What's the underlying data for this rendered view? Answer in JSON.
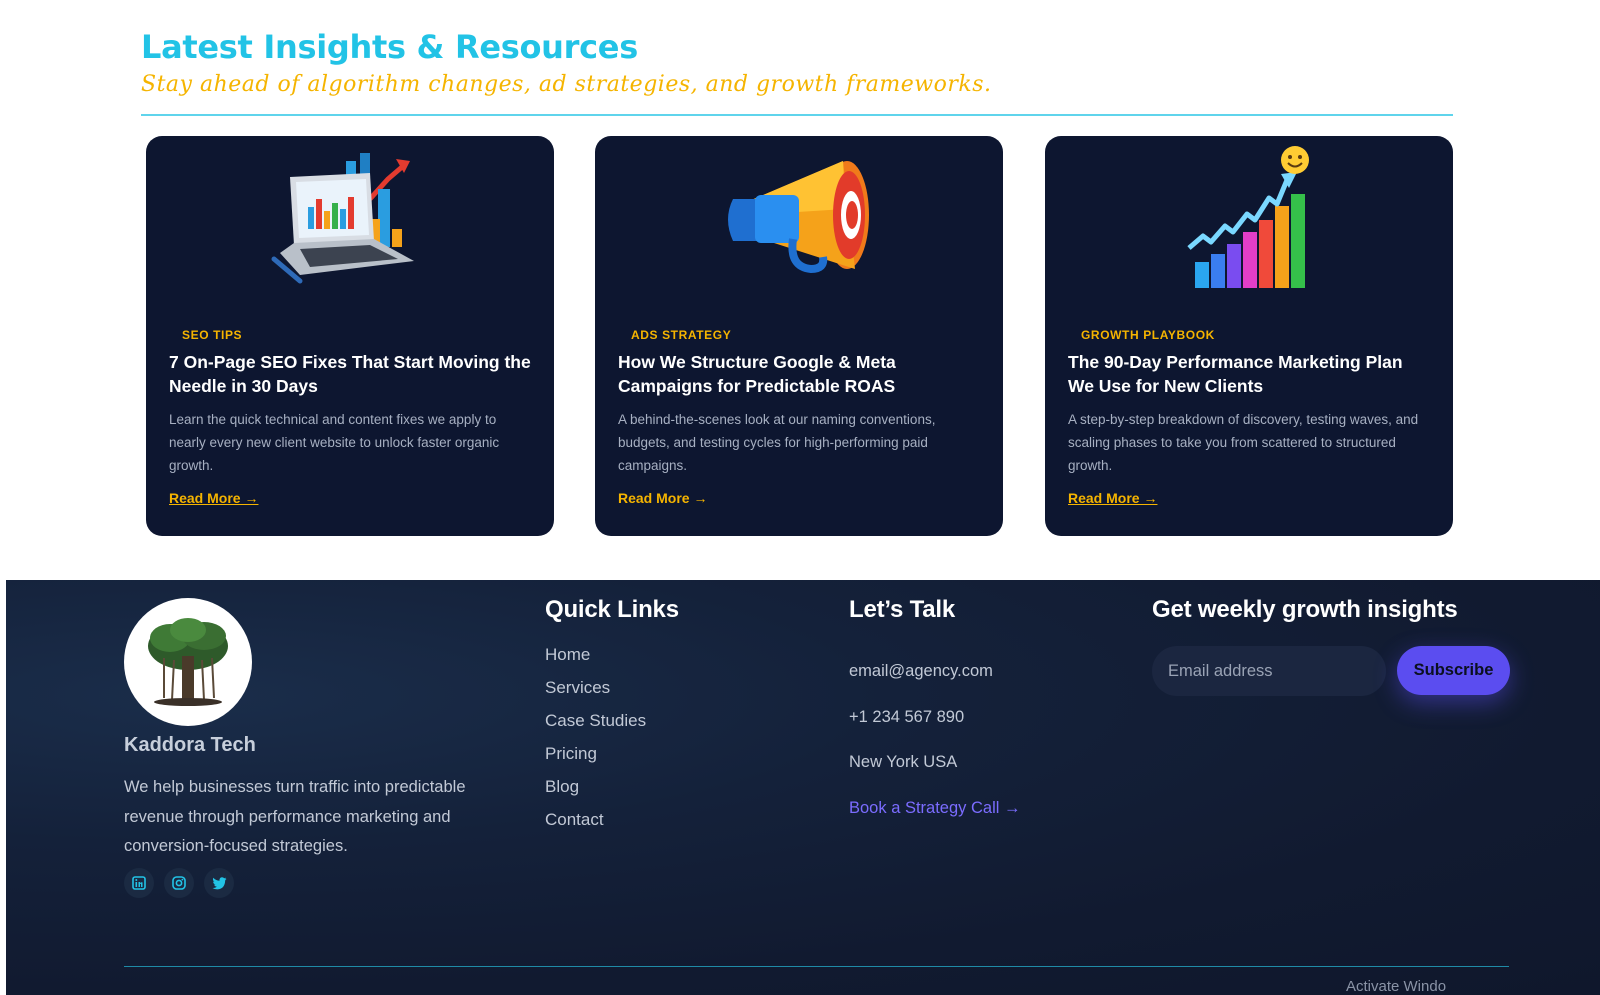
{
  "insights": {
    "title": "Latest Insights & Resources",
    "subtitle": "Stay ahead of algorithm changes, ad strategies, and growth frameworks.",
    "cards": [
      {
        "image_icon": "laptop-chart-icon",
        "tag": "SEO TIPS",
        "title": "7 On-Page SEO Fixes That Start Moving the Needle in 30 Days",
        "description": "Learn the quick technical and content fixes we apply to nearly every new client website to unlock faster organic growth.",
        "link_label": "Read More →"
      },
      {
        "image_icon": "megaphone-icon",
        "tag": "ADS STRATEGY",
        "title": "How We Structure Google & Meta Campaigns for Predictable ROAS",
        "description": "A behind-the-scenes look at our naming conventions, budgets, and testing cycles for high-performing paid campaigns.",
        "link_label": "Read More →"
      },
      {
        "image_icon": "growth-bars-icon",
        "tag": "GROWTH PLAYBOOK",
        "title": "The 90-Day Performance Marketing Plan We Use for New Clients",
        "description": "A step-by-step breakdown of discovery, testing waves, and scaling phases to take you from scattered to structured growth.",
        "link_label": "Read More →"
      }
    ]
  },
  "footer": {
    "logo_icon": "tree-icon",
    "brand": "Kaddora Tech",
    "about": "We help businesses turn traffic into predictable revenue through performance marketing and conversion-focused strategies.",
    "socials": [
      "linkedin-icon",
      "instagram-icon",
      "twitter-icon"
    ],
    "quick_links": {
      "heading": "Quick Links",
      "items": [
        "Home",
        "Services",
        "Case Studies",
        "Pricing",
        "Blog",
        "Contact"
      ]
    },
    "contact": {
      "heading": "Let’s Talk",
      "email": "email@agency.com",
      "phone": "+1 234 567 890",
      "location": "New York USA",
      "cta": "Book a Strategy Call →"
    },
    "newsletter": {
      "heading": "Get weekly growth insights",
      "placeholder": "Email address",
      "button": "Subscribe"
    },
    "copyright_partial": "Activate Windo"
  },
  "colors": {
    "accent_cyan": "#22c3e6",
    "accent_yellow": "#f5b400",
    "card_bg": "#0d1630",
    "footer_bg": "#111a30",
    "button_purple": "#5b4df0",
    "link_purple": "#7b6cff"
  }
}
